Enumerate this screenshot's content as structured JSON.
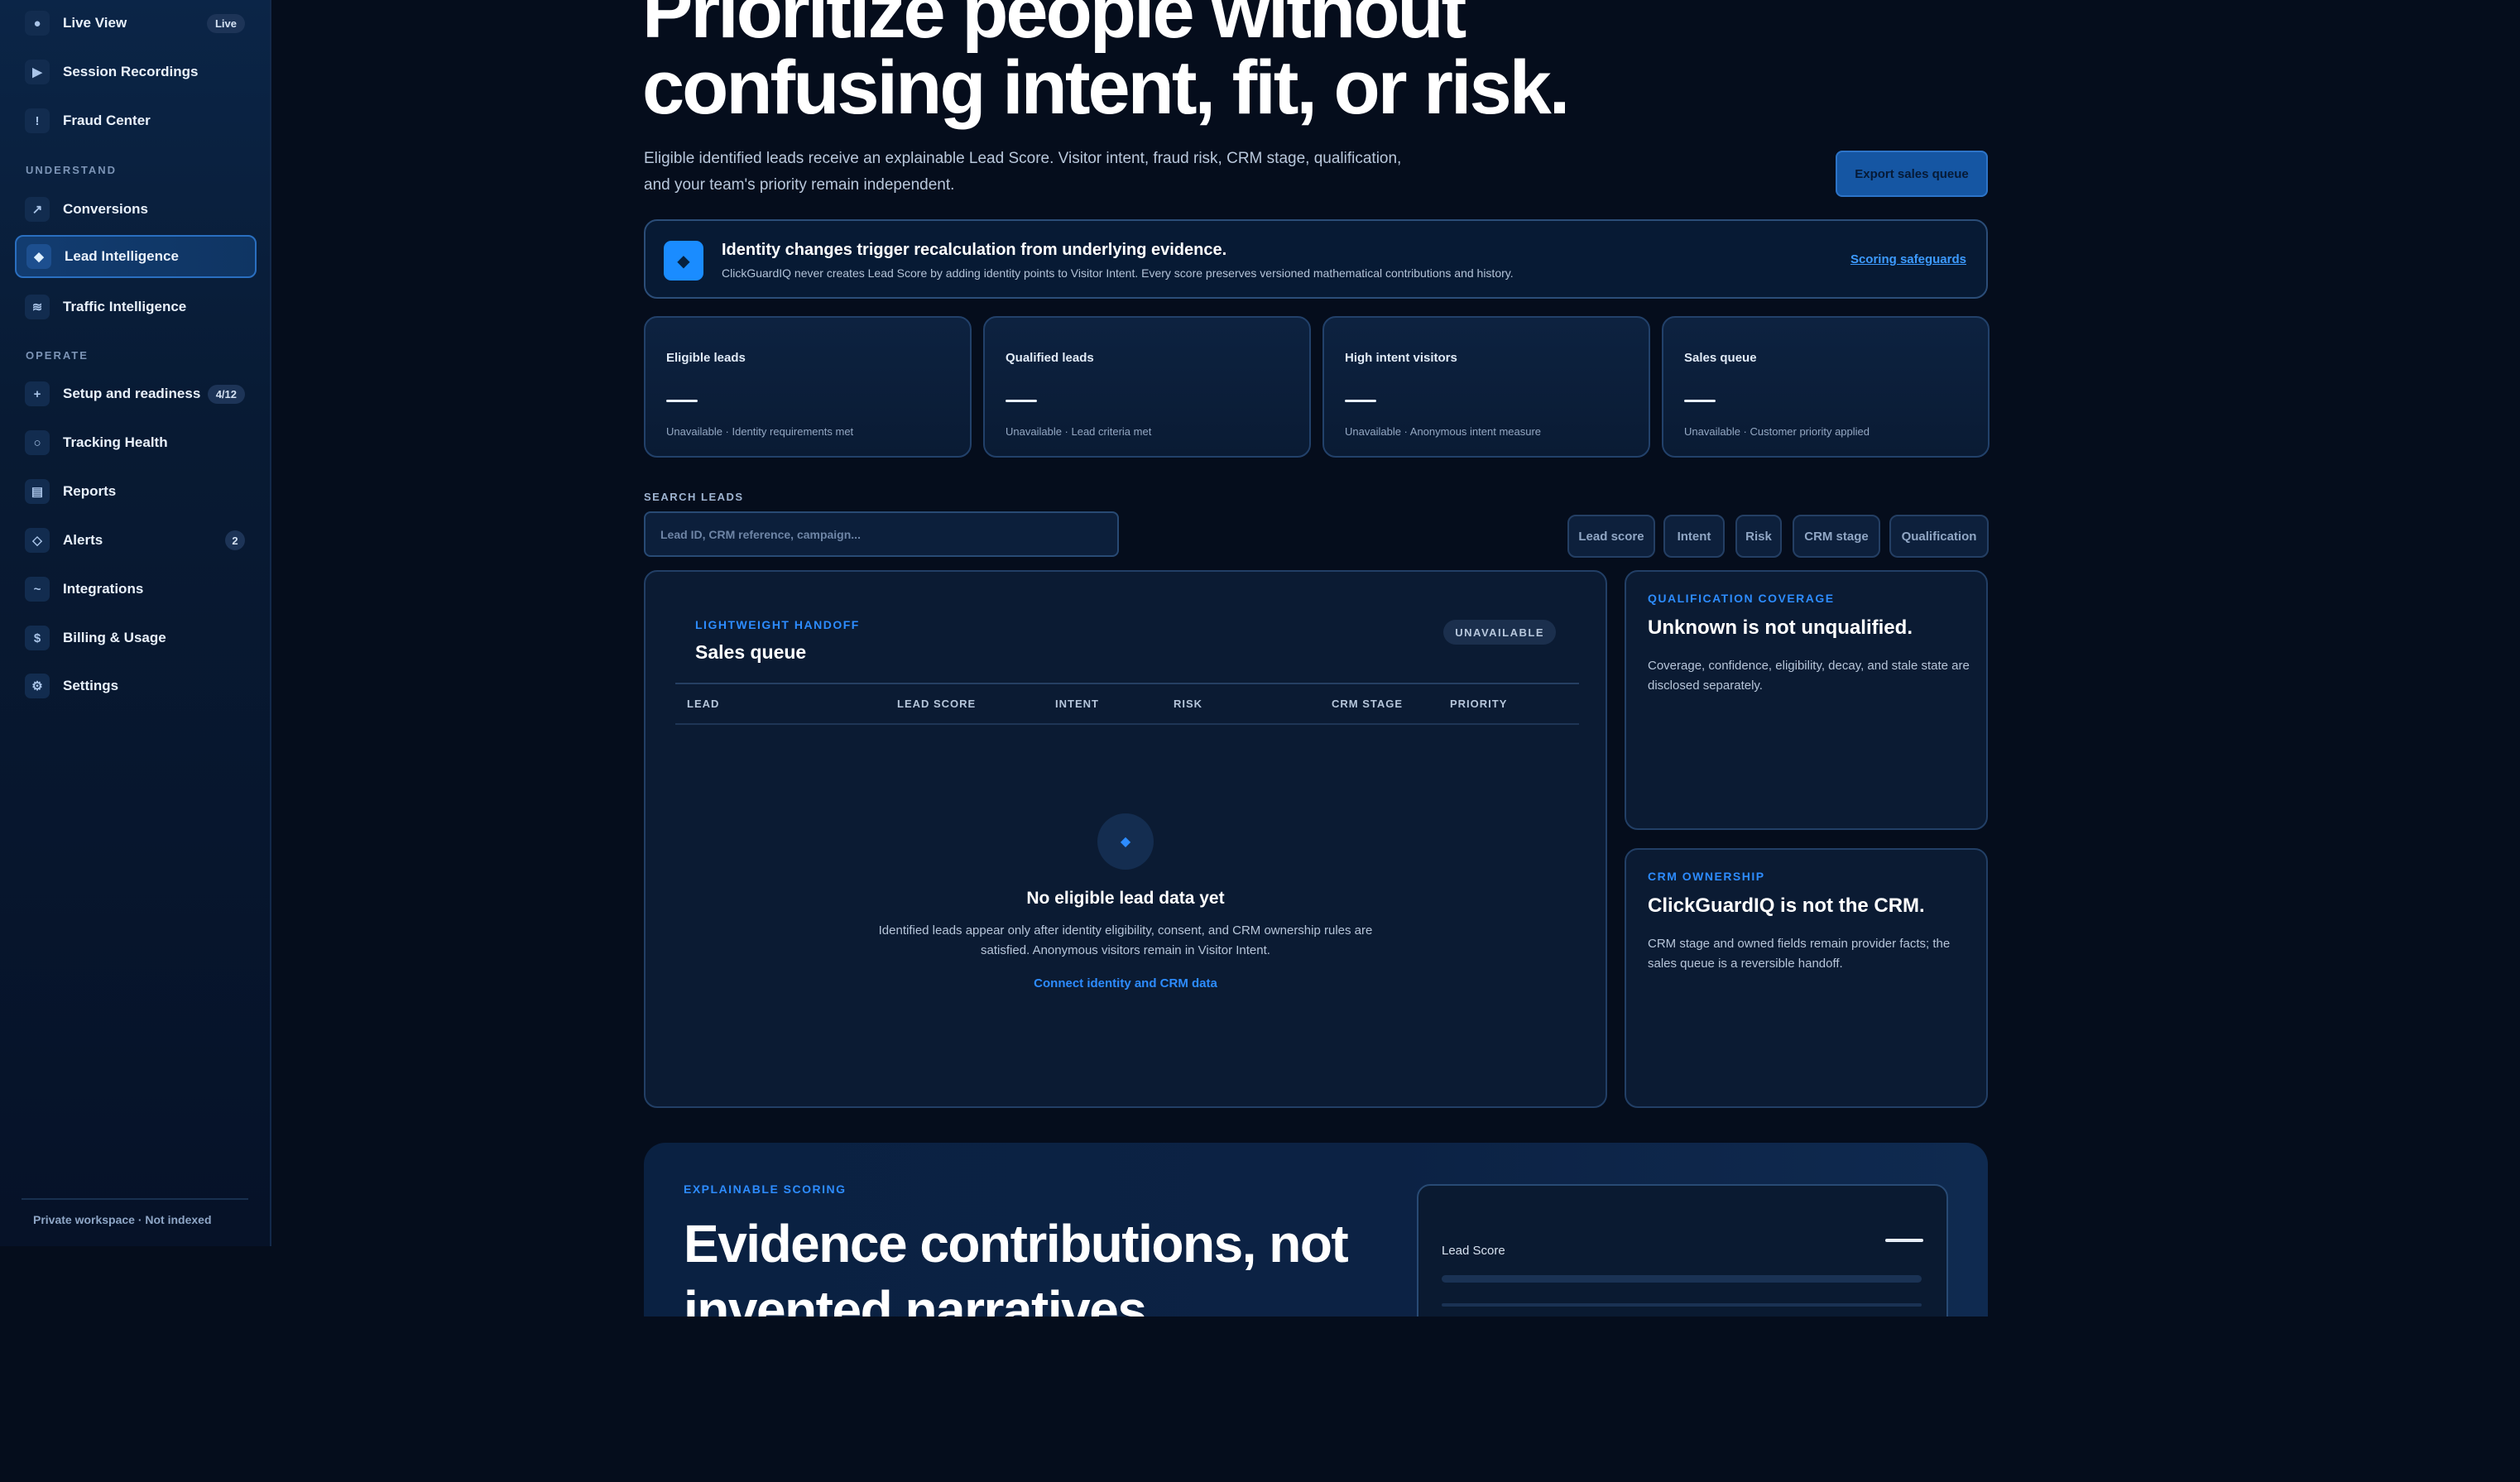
{
  "sidebar": {
    "items": [
      {
        "icon": "dot-icon",
        "glyph": "●",
        "label": "Live View",
        "badge": "Live"
      },
      {
        "icon": "play-icon",
        "glyph": "▶",
        "label": "Session Recordings"
      },
      {
        "icon": "alert-icon",
        "glyph": "!",
        "label": "Fraud Center"
      },
      {
        "icon": "arrow-up-right-icon",
        "glyph": "↗",
        "label": "Conversions"
      },
      {
        "icon": "diamond-icon",
        "glyph": "◆",
        "label": "Lead Intelligence",
        "active": true
      },
      {
        "icon": "waves-icon",
        "glyph": "≋",
        "label": "Traffic Intelligence"
      },
      {
        "icon": "plus-icon",
        "glyph": "+",
        "label": "Setup and readiness",
        "badge": "4/12"
      },
      {
        "icon": "circle-icon",
        "glyph": "○",
        "label": "Tracking Health"
      },
      {
        "icon": "report-icon",
        "glyph": "▤",
        "label": "Reports"
      },
      {
        "icon": "diamond-outline-icon",
        "glyph": "◇",
        "label": "Alerts",
        "badge": "2"
      },
      {
        "icon": "link-icon",
        "glyph": "~",
        "label": "Integrations"
      },
      {
        "icon": "dollar-icon",
        "glyph": "$",
        "label": "Billing & Usage"
      },
      {
        "icon": "gear-icon",
        "glyph": "⚙",
        "label": "Settings"
      }
    ],
    "sections": {
      "understand": "UNDERSTAND",
      "operate": "OPERATE"
    },
    "footer": "Private workspace · Not indexed"
  },
  "hero": {
    "title_line1": "Prioritize people without",
    "title_line2": "confusing intent, fit, or risk.",
    "desc_line1": "Eligible identified leads receive an explainable Lead Score. Visitor intent, fraud risk, CRM stage, qualification,",
    "desc_line2": "and your team's priority remain independent.",
    "export_label": "Export sales queue"
  },
  "banner": {
    "icon": "diamond-icon",
    "title": "Identity changes trigger recalculation from underlying evidence.",
    "subtitle": "ClickGuardIQ never creates Lead Score by adding identity points to Visitor Intent. Every score preserves versioned mathematical contributions and history.",
    "link": "Scoring safeguards"
  },
  "stats": [
    {
      "label": "Eligible leads",
      "value": "—",
      "note": "Unavailable · Identity requirements met"
    },
    {
      "label": "Qualified leads",
      "value": "—",
      "note": "Unavailable · Lead criteria met"
    },
    {
      "label": "High intent visitors",
      "value": "—",
      "note": "Unavailable · Anonymous intent measure"
    },
    {
      "label": "Sales queue",
      "value": "—",
      "note": "Unavailable · Customer priority applied"
    }
  ],
  "search": {
    "label": "SEARCH LEADS",
    "placeholder": "Lead ID, CRM reference, campaign...",
    "value": ""
  },
  "filters": [
    "Lead score",
    "Intent",
    "Risk",
    "CRM stage",
    "Qualification"
  ],
  "queue": {
    "eyebrow": "LIGHTWEIGHT HANDOFF",
    "title": "Sales queue",
    "status": "UNAVAILABLE",
    "columns": [
      "LEAD",
      "LEAD SCORE",
      "INTENT",
      "RISK",
      "CRM STAGE",
      "PRIORITY"
    ],
    "empty_title": "No eligible lead data yet",
    "empty_desc": "Identified leads appear only after identity eligibility, consent, and CRM ownership rules are satisfied. Anonymous visitors remain in Visitor Intent.",
    "empty_link": "Connect identity and CRM data"
  },
  "info_cards": [
    {
      "eyebrow": "QUALIFICATION COVERAGE",
      "title": "Unknown is not unqualified.",
      "desc": "Coverage, confidence, eligibility, decay, and stale state are disclosed separately."
    },
    {
      "eyebrow": "CRM OWNERSHIP",
      "title": "ClickGuardIQ is not the CRM.",
      "desc": "CRM stage and owned fields remain provider facts; the sales queue is a reversible handoff."
    }
  ],
  "scoring": {
    "eyebrow": "EXPLAINABLE SCORING",
    "title": "Evidence contributions, not invented narratives",
    "card_label": "Lead Score",
    "card_value": "—"
  },
  "colors": {
    "background": "#050d1c",
    "accent": "#2d8cff",
    "active_nav": "#123c70",
    "card_border": "#223f66"
  }
}
